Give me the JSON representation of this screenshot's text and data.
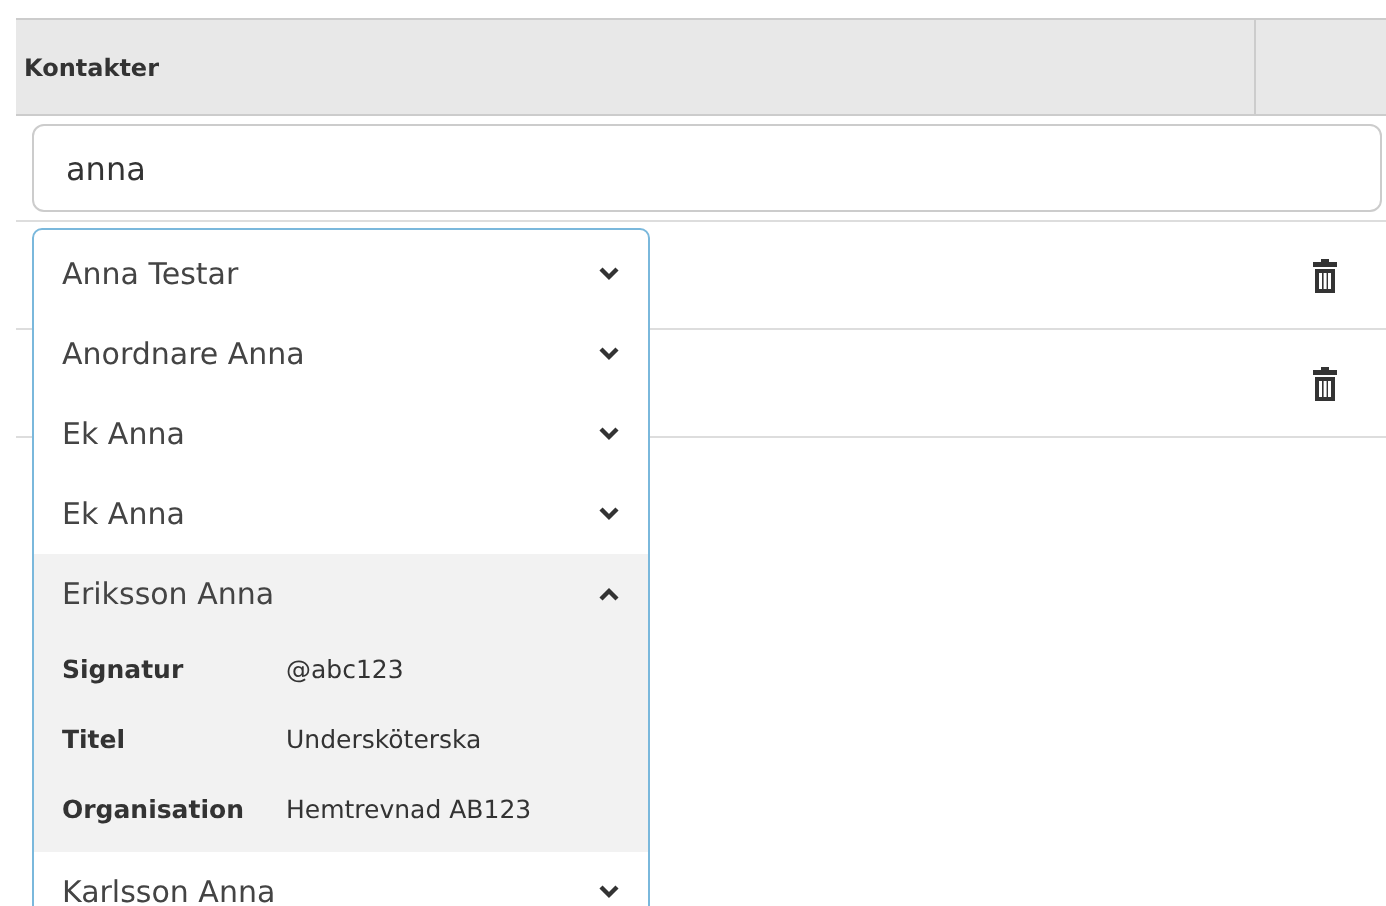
{
  "table": {
    "columns": [
      {
        "label": "Kontakter"
      }
    ],
    "search": {
      "value": "anna"
    },
    "rows": [
      {
        "kind": "contact"
      },
      {
        "kind": "contact"
      }
    ]
  },
  "suggestions": [
    {
      "name": "Anna Testar",
      "expanded": false
    },
    {
      "name": "Anordnare Anna",
      "expanded": false
    },
    {
      "name": "Ek Anna",
      "expanded": false
    },
    {
      "name": "Ek Anna",
      "expanded": false
    },
    {
      "name": "Eriksson Anna",
      "expanded": true,
      "details": [
        {
          "label": "Signatur",
          "value": "@abc123"
        },
        {
          "label": "Titel",
          "value": "Undersköterska"
        },
        {
          "label": "Organisation",
          "value": "Hemtrevnad AB123"
        }
      ]
    },
    {
      "name": "Karlsson Anna",
      "expanded": false
    }
  ]
}
